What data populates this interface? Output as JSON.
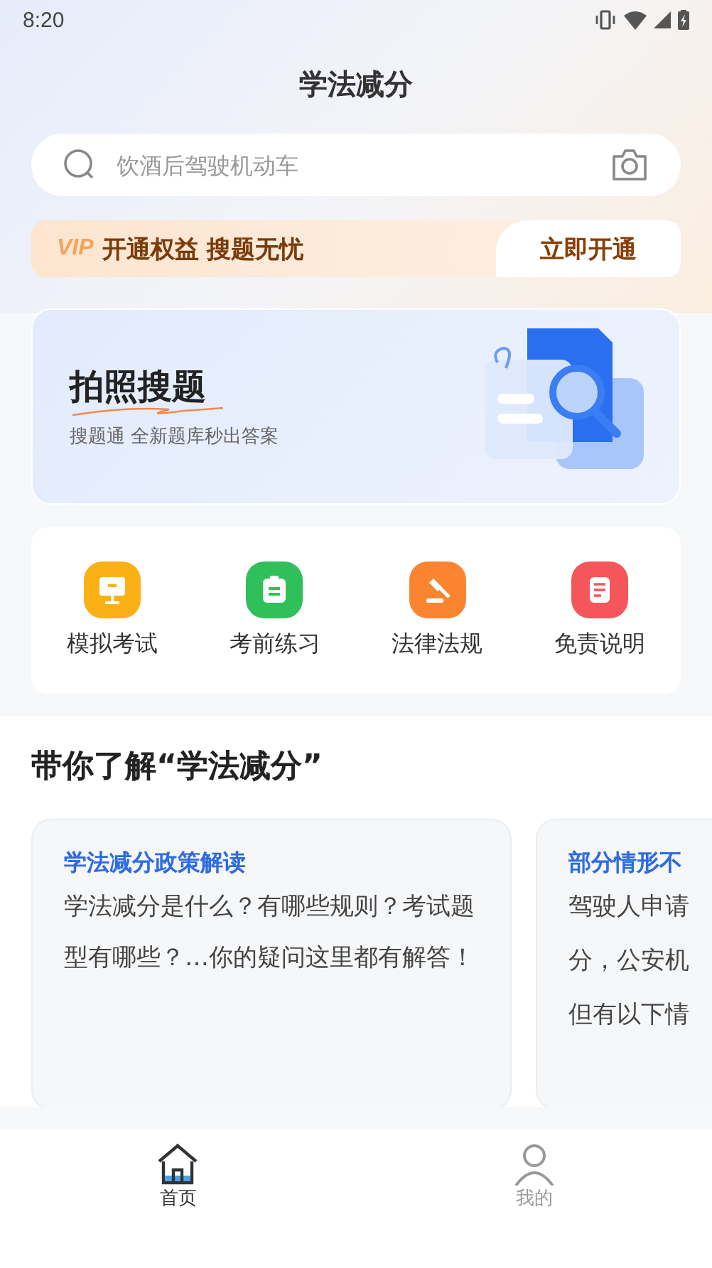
{
  "status_bar": {
    "time": "8:20"
  },
  "title": "学法减分",
  "search": {
    "placeholder": "饮酒后驾驶机动车"
  },
  "vip_banner": {
    "badge": "VIP",
    "text": "开通权益 搜题无忧",
    "button": "立即开通"
  },
  "photo_search": {
    "title": "拍照搜题",
    "subtitle": "搜题通 全新题库秒出答案"
  },
  "shortcuts": [
    {
      "label": "模拟考试",
      "kind": "monitor",
      "color": "#fbb116"
    },
    {
      "label": "考前练习",
      "kind": "clipboard",
      "color": "#2fc05a"
    },
    {
      "label": "法律法规",
      "kind": "gavel",
      "color": "#fb8431"
    },
    {
      "label": "免责说明",
      "kind": "document",
      "color": "#f5565a"
    }
  ],
  "intro": {
    "title": "带你了解“学法减分”",
    "cards": [
      {
        "title": "学法减分政策解读",
        "lines": [
          "学法减分是什么？有哪些规则？考试题型有哪些？…你的疑问这里都有解答！"
        ]
      },
      {
        "title": "部分情形不",
        "lines": [
          "驾驶人申请",
          "分，公安机",
          "但有以下情"
        ]
      }
    ]
  },
  "tabs": [
    {
      "label": "首页",
      "kind": "home",
      "selected": true
    },
    {
      "label": "我的",
      "kind": "user",
      "selected": false
    }
  ]
}
